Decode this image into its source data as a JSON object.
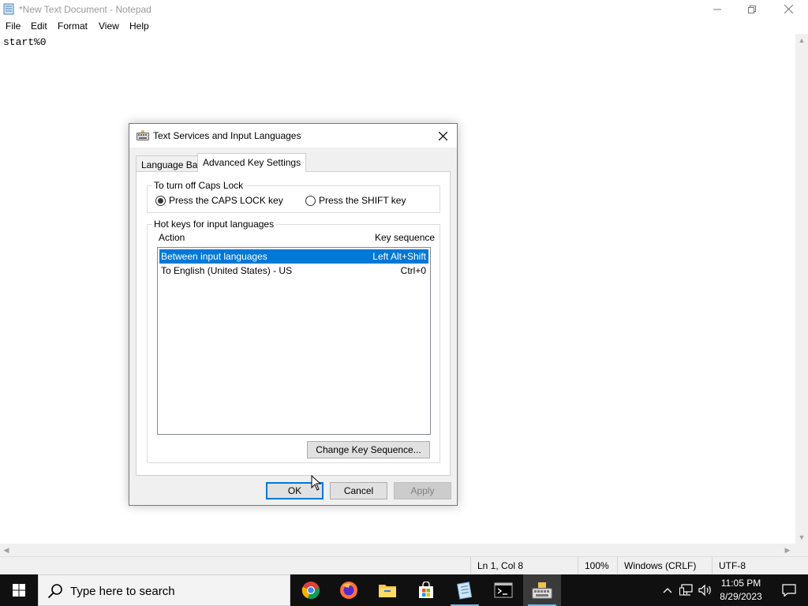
{
  "notepad": {
    "title": "*New Text Document - Notepad",
    "menu": [
      "File",
      "Edit",
      "Format",
      "View",
      "Help"
    ],
    "content": "start%0",
    "status": {
      "position": "Ln 1, Col 8",
      "zoom": "100%",
      "line_ending": "Windows (CRLF)",
      "encoding": "UTF-8"
    }
  },
  "dialog": {
    "title": "Text Services and Input Languages",
    "tabs": [
      "Language Bar",
      "Advanced Key Settings"
    ],
    "active_tab": "Advanced Key Settings",
    "caps_lock": {
      "label": "To turn off Caps Lock",
      "options": [
        "Press the CAPS LOCK key",
        "Press the SHIFT key"
      ],
      "selected": "Press the CAPS LOCK key"
    },
    "hotkeys": {
      "label": "Hot keys for input languages",
      "columns": [
        "Action",
        "Key sequence"
      ],
      "rows": [
        {
          "action": "Between input languages",
          "sequence": "Left Alt+Shift",
          "selected": true
        },
        {
          "action": "To English (United States) - US",
          "sequence": "Ctrl+0",
          "selected": false
        }
      ],
      "change_button": "Change Key Sequence..."
    },
    "buttons": {
      "ok": "OK",
      "cancel": "Cancel",
      "apply": "Apply"
    }
  },
  "taskbar": {
    "search_placeholder": "Type here to search",
    "apps": [
      "chrome-icon",
      "firefox-icon",
      "file-explorer-icon",
      "store-icon",
      "notepad-icon",
      "terminal-icon",
      "keyboard-settings-icon"
    ],
    "time": "11:05 PM",
    "date": "8/29/2023"
  },
  "colors": {
    "selection": "#0078d7",
    "taskbar": "#101010",
    "dialog_bg": "#f0f0f0"
  }
}
